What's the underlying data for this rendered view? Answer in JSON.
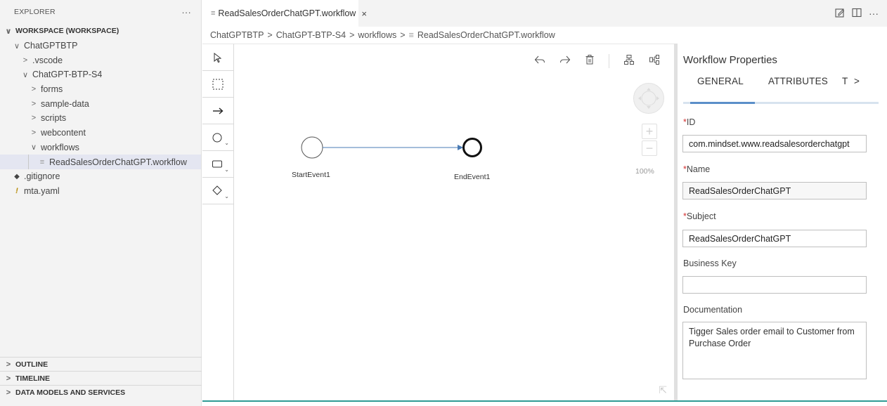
{
  "explorer": {
    "title": "EXPLORER",
    "more": "···",
    "workspace": "WORKSPACE (WORKSPACE)",
    "tree": [
      {
        "label": "ChatGPTBTP",
        "chevron": "∨",
        "depth": 1
      },
      {
        "label": ".vscode",
        "chevron": ">",
        "depth": 2
      },
      {
        "label": "ChatGPT-BTP-S4",
        "chevron": "∨",
        "depth": 2
      },
      {
        "label": "forms",
        "chevron": ">",
        "depth": 3
      },
      {
        "label": "sample-data",
        "chevron": ">",
        "depth": 3
      },
      {
        "label": "scripts",
        "chevron": ">",
        "depth": 3
      },
      {
        "label": "webcontent",
        "chevron": ">",
        "depth": 3
      },
      {
        "label": "workflows",
        "chevron": "∨",
        "depth": 3
      },
      {
        "label": "ReadSalesOrderChatGPT.workflow",
        "icon": "≡",
        "depth": 4
      },
      {
        "label": ".gitignore",
        "icon": "◆",
        "depth": 1
      },
      {
        "label": "mta.yaml",
        "icon": "!",
        "depth": 1
      }
    ],
    "bottom_sections": [
      "OUTLINE",
      "TIMELINE",
      "DATA MODELS AND SERVICES"
    ]
  },
  "tab": {
    "icon": "≡",
    "label": "ReadSalesOrderChatGPT.workflow",
    "close": "×"
  },
  "breadcrumb": {
    "parts": [
      "ChatGPTBTP",
      "ChatGPT-BTP-S4",
      "workflows",
      "ReadSalesOrderChatGPT.workflow"
    ],
    "separator": ">",
    "file_icon": "≡"
  },
  "canvas": {
    "start_event": "StartEvent1",
    "end_event": "EndEvent1",
    "zoom": "100%"
  },
  "properties": {
    "title": "Workflow Properties",
    "tabs": [
      "GENERAL",
      "ATTRIBUTES",
      "T"
    ],
    "more_tabs": ">",
    "id_label": "ID",
    "id_value": "com.mindset.www.readsalesorderchatgpt",
    "name_label": "Name",
    "name_value": "ReadSalesOrderChatGPT",
    "subject_label": "Subject",
    "subject_value": "ReadSalesOrderChatGPT",
    "business_key_label": "Business Key",
    "business_key_value": "",
    "documentation_label": "Documentation",
    "documentation_value": "Tigger Sales order email to Customer from Purchase Order",
    "required_marker": "*"
  },
  "colors": {
    "accent": "#5b8fc9",
    "required": "#d32f2f",
    "status_line": "#2f9b95",
    "sequence_flow": "#4a7bb4"
  }
}
